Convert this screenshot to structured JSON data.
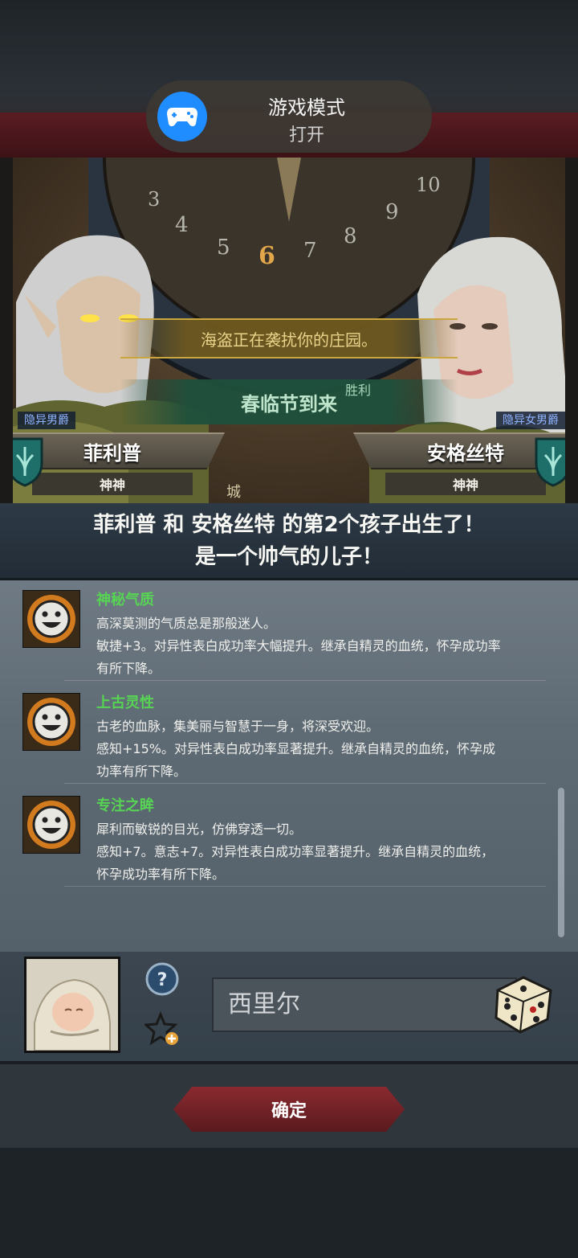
{
  "toast": {
    "title": "游戏模式",
    "status": "打开"
  },
  "scene": {
    "dial_numbers": [
      "3",
      "4",
      "5",
      "6",
      "7",
      "8",
      "9",
      "10"
    ],
    "event_pirate": "海盗正在袭扰你的庄园。",
    "event_spring": "春临节到来",
    "event_small": "胜利",
    "castle_label": "城"
  },
  "father": {
    "rank": "隐异男爵",
    "name": "菲利普",
    "house": "神神"
  },
  "mother": {
    "rank": "隐异女男爵",
    "name": "安格丝特",
    "house": "神神"
  },
  "announcement": {
    "line1": "菲利普 和 安格丝特 的第2个孩子出生了！",
    "line2": "是一个帅气的儿子！"
  },
  "traits": [
    {
      "name": "神秘气质",
      "line1": "高深莫测的气质总是那般迷人。",
      "line2": "敏捷+3。对异性表白成功率大幅提升。继承自精灵的血统，怀孕成功率",
      "line3": "有所下降。"
    },
    {
      "name": "上古灵性",
      "line1": "古老的血脉，集美丽与智慧于一身，将深受欢迎。",
      "line2": "感知+15%。对异性表白成功率显著提升。继承自精灵的血统，怀孕成",
      "line3": "功率有所下降。"
    },
    {
      "name": "专注之眸",
      "line1": "犀利而敏锐的目光，仿佛穿透一切。",
      "line2": "感知+7。意志+7。对异性表白成功率显著提升。继承自精灵的血统，",
      "line3": "怀孕成功率有所下降。"
    }
  ],
  "child": {
    "name_value": "西里尔"
  },
  "confirm_label": "确定",
  "colors": {
    "trait_name": "#57d454",
    "rank_tag": "#8fb4ff",
    "confirm_bg": "#8a2a2f",
    "toast_icon": "#1f8cff"
  },
  "icons": [
    "gamepad-icon",
    "smiley-trait-icon",
    "help-icon",
    "star-plus-icon",
    "dice-icon",
    "heraldic-shield-icon"
  ]
}
